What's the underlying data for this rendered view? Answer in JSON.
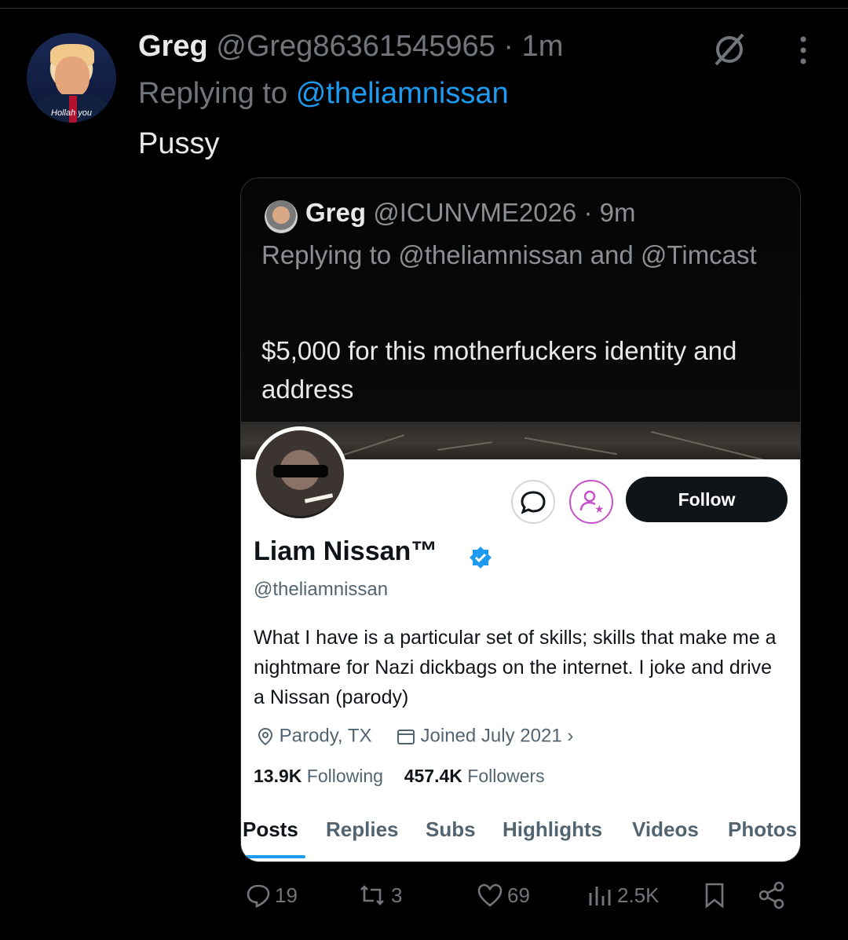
{
  "reply": {
    "author_name": "Greg",
    "author_handle": "@Greg86361545965 · 1m",
    "avatar_caption": "Hollah you",
    "replying_prefix": "Replying to",
    "replying_to": "@theliamnissan",
    "text": "Pussy"
  },
  "quoted": {
    "author_name": "Greg",
    "author_handle": "@ICUNVME2026 · 9m",
    "replying_line": "Replying to @theliamnissan and @Timcast",
    "text": "$5,000 for this motherfuckers identity and address"
  },
  "profile": {
    "name": "Liam Nissan™",
    "handle": "@theliamnissan",
    "bio": "What I have is a particular set of skills; skills that make me a nightmare for Nazi dickbags on the internet. I joke and drive a Nissan (parody)",
    "location": "Parody, TX",
    "joined": "Joined July 2021",
    "following_count": "13.9K",
    "following_label": "Following",
    "followers_count": "457.4K",
    "followers_label": "Followers",
    "follow_button": "Follow",
    "tabs": [
      "Posts",
      "Replies",
      "Subs",
      "Highlights",
      "Videos",
      "Photos"
    ],
    "active_tab": "Posts"
  },
  "actions": {
    "replies": "19",
    "reposts": "3",
    "likes": "69",
    "views": "2.5K"
  },
  "colors": {
    "background": "#000000",
    "accent": "#1d9bf0",
    "muted": "#71767b",
    "text": "#e7e9ea",
    "notify_purple": "#c552c9"
  },
  "icons": [
    "grok-icon",
    "more-icon",
    "message-icon",
    "notify-icon",
    "verified-icon",
    "location-icon",
    "calendar-icon",
    "reply-icon",
    "repost-icon",
    "like-icon",
    "views-icon",
    "bookmark-icon",
    "share-icon"
  ]
}
